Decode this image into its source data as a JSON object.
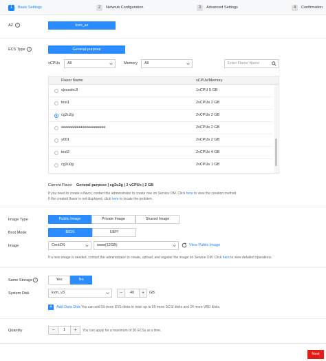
{
  "steps": [
    {
      "num": "1",
      "label": "Basic Settings"
    },
    {
      "num": "2",
      "label": "Network Configuration"
    },
    {
      "num": "3",
      "label": "Advanced Settings"
    },
    {
      "num": "4",
      "label": "Confirmation"
    }
  ],
  "az": {
    "label": "AZ",
    "value": "kvm_az"
  },
  "ecs_type": {
    "label": "ECS Type",
    "value": "General-purpose"
  },
  "filters": {
    "vcpus_label": "vCPUs",
    "vcpus_value": "All",
    "memory_label": "Memory",
    "memory_value": "All",
    "search_placeholder": "Enter Flavor Name"
  },
  "flavor_table": {
    "headers": [
      "Flavor Name",
      "vCPUs/Memory"
    ],
    "rows": [
      {
        "name": "sjxceshi.8",
        "spec": "1vCPU 5 GB"
      },
      {
        "name": "test1",
        "spec": "2vCPUs 2 GB"
      },
      {
        "name": "cg2u2g",
        "spec": "2vCPUs 2 GB"
      },
      {
        "name": "aaaaaaaaaaaaaaaaaaaaa",
        "spec": "2vCPUs 2 GB"
      },
      {
        "name": "y001",
        "spec": "2vCPUs 2 GB"
      },
      {
        "name": "test2",
        "spec": "2vCPUs 4 GB"
      },
      {
        "name": "cg2u0g",
        "spec": "2vCPUs 1 GB"
      }
    ]
  },
  "current_flavor": {
    "label": "Current Flavor",
    "value": "General-purpose | cg2u2g | 2 vCPUs | 2 GB",
    "note1_a": "If you need to create a flavor, contact the administrator to create one on Service OM. Click ",
    "note1_link": "here",
    "note1_b": " to view the creation method.",
    "note2_a": "If the created flavor is not displayed, click ",
    "note2_link": "here",
    "note2_b": " to locate the problem."
  },
  "image_type": {
    "label": "Image Type",
    "options": [
      "Public Image",
      "Private Image",
      "Shared Image"
    ]
  },
  "boot_mode": {
    "label": "Boot Mode",
    "options": [
      "BIOS",
      "UEFI"
    ]
  },
  "image": {
    "label": "Image",
    "os": "CentOS",
    "version": "www(12GB)",
    "view_link": "View Public Image",
    "note_a": "If a new image is needed, contact the administrator to create, upload, and register the image on Service OM. Click ",
    "note_link": "here",
    "note_b": " to view detailed operations."
  },
  "same_storage": {
    "label": "Same Storage",
    "options": [
      "Yes",
      "No"
    ]
  },
  "system_disk": {
    "label": "System Disk",
    "type": "kvm_v3",
    "size": "40",
    "unit": "GB",
    "add_label": "Add Data Disk",
    "add_note": "You can add 59 more EVS disks in total: up to 59 more SCSI disks and 24 more VBD disks."
  },
  "quantity": {
    "label": "Quantity",
    "value": "1",
    "note": "You can apply for a maximum of 30 ECSs at a time."
  },
  "footer": {
    "next_label": "Next"
  }
}
